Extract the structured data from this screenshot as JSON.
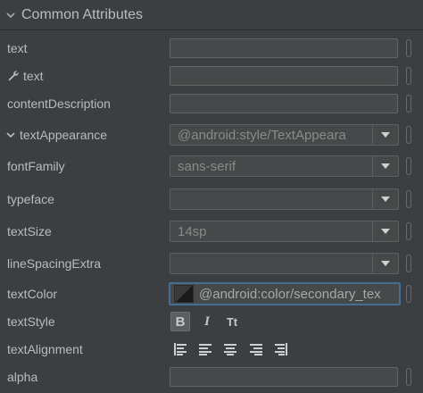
{
  "section": {
    "title": "Common Attributes"
  },
  "rows": {
    "text": {
      "label": "text"
    },
    "tools_text": {
      "label": "text"
    },
    "content_description": {
      "label": "contentDescription"
    },
    "text_appearance": {
      "label": "textAppearance",
      "value": "@android:style/TextAppeara"
    },
    "font_family": {
      "label": "fontFamily",
      "value": "sans-serif"
    },
    "typeface": {
      "label": "typeface",
      "value": ""
    },
    "text_size": {
      "label": "textSize",
      "value": "14sp"
    },
    "line_spacing_extra": {
      "label": "lineSpacingExtra",
      "value": ""
    },
    "text_color": {
      "label": "textColor",
      "value": "@android:color/secondary_tex"
    },
    "text_style": {
      "label": "textStyle",
      "bold": "B",
      "italic": "I",
      "caps": "Tt",
      "bold_selected": true
    },
    "text_alignment": {
      "label": "textAlignment"
    },
    "alpha": {
      "label": "alpha"
    }
  },
  "icons": {
    "header": "chevron-down-icon",
    "tools": "wrench-icon",
    "expand": "chevron-down-icon",
    "dropdown": "triangle-down-icon",
    "align": [
      "align-start-icon",
      "align-left-icon",
      "align-center-icon",
      "align-right-icon",
      "align-end-icon"
    ]
  },
  "colors": {
    "background": "#3c3f41",
    "focus_border": "#466d94",
    "text": "#bbbbbb"
  }
}
